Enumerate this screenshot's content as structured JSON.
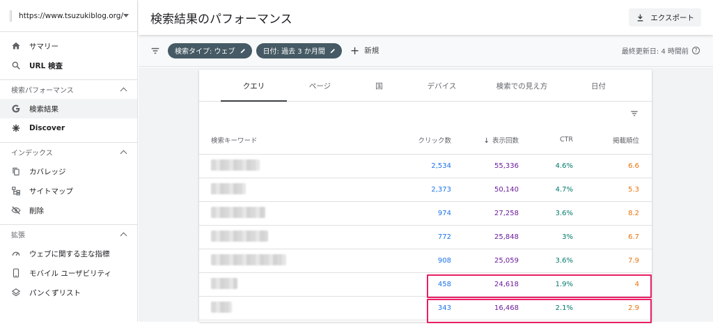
{
  "sidebar": {
    "property_url": "https://www.tsuzukiblog.org/",
    "top_items": [
      {
        "label": "サマリー"
      },
      {
        "label": "URL 検査"
      }
    ],
    "sections": [
      {
        "title": "検索パフォーマンス",
        "items": [
          {
            "label": "検索結果",
            "active": true
          },
          {
            "label": "Discover",
            "bold": true
          }
        ]
      },
      {
        "title": "インデックス",
        "items": [
          {
            "label": "カバレッジ"
          },
          {
            "label": "サイトマップ"
          },
          {
            "label": "削除"
          }
        ]
      },
      {
        "title": "拡張",
        "items": [
          {
            "label": "ウェブに関する主な指標"
          },
          {
            "label": "モバイル ユーザビリティ"
          },
          {
            "label": "パンくずリスト"
          }
        ]
      }
    ]
  },
  "header": {
    "title": "検索結果のパフォーマンス",
    "export_label": "エクスポート"
  },
  "filters": {
    "chips": [
      {
        "label": "検索タイプ: ウェブ"
      },
      {
        "label": "日付: 過去 3 か月間"
      }
    ],
    "new_label": "新規",
    "updated_label": "最終更新日: 4 時間前"
  },
  "tabs": [
    {
      "label": "クエリ",
      "active": true
    },
    {
      "label": "ページ"
    },
    {
      "label": "国"
    },
    {
      "label": "デバイス"
    },
    {
      "label": "検索での見え方"
    },
    {
      "label": "日付"
    }
  ],
  "table": {
    "columns": {
      "keyword": "検索キーワード",
      "clicks": "クリック数",
      "impressions": "表示回数",
      "ctr": "CTR",
      "position": "掲載順位"
    },
    "rows": [
      {
        "clicks": "2,534",
        "impressions": "55,336",
        "ctr": "4.6%",
        "position": "6.6"
      },
      {
        "clicks": "2,373",
        "impressions": "50,140",
        "ctr": "4.7%",
        "position": "5.3"
      },
      {
        "clicks": "974",
        "impressions": "27,258",
        "ctr": "3.6%",
        "position": "8.2"
      },
      {
        "clicks": "772",
        "impressions": "25,848",
        "ctr": "3%",
        "position": "6.7"
      },
      {
        "clicks": "908",
        "impressions": "25,059",
        "ctr": "3.6%",
        "position": "7.9"
      },
      {
        "clicks": "458",
        "impressions": "24,618",
        "ctr": "1.9%",
        "position": "4"
      },
      {
        "clicks": "343",
        "impressions": "16,468",
        "ctr": "2.1%",
        "position": "2.9"
      }
    ]
  },
  "colors": {
    "clicks": "#1a73e8",
    "impressions": "#6a1b9a",
    "ctr": "#00796b",
    "position": "#e8710a",
    "highlight": "#e91e63",
    "chip": "#455a64"
  }
}
